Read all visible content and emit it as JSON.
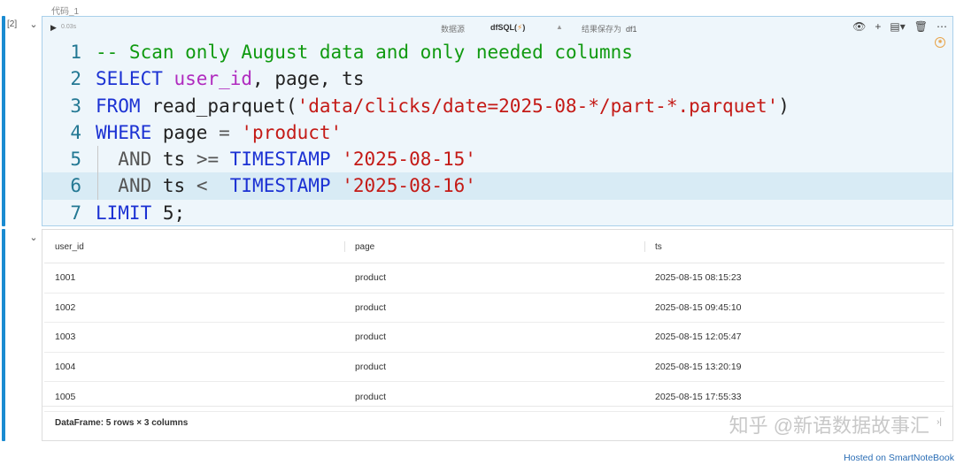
{
  "cell": {
    "title": "代码_1",
    "exec_count": "[2]",
    "collapse_icon": "chevron-down-icon"
  },
  "toolbar": {
    "run_icon": "▶",
    "elapsed": "0.03s",
    "datasource_label": "数据源",
    "language_label": "dfSQL(",
    "language_bolt": "⚡",
    "language_close": ")",
    "language_caret": "▲",
    "save_as_label": "结果保存为",
    "save_as_value": "df1",
    "icons": [
      "eye-icon",
      "plus-icon",
      "layers-icon",
      "trash-icon",
      "more-icon"
    ]
  },
  "code": {
    "lines": [
      {
        "n": "1",
        "parts": [
          {
            "t": "-- Scan only August data and only needed columns",
            "c": "cm"
          }
        ]
      },
      {
        "n": "2",
        "parts": [
          {
            "t": "SELECT",
            "c": "kw"
          },
          {
            "t": " "
          },
          {
            "t": "user_id",
            "c": "id"
          },
          {
            "t": ", page, ts"
          }
        ]
      },
      {
        "n": "3",
        "parts": [
          {
            "t": "FROM",
            "c": "kw"
          },
          {
            "t": " read_parquet("
          },
          {
            "t": "'data/clicks/date=2025-08-*/part-*.parquet'",
            "c": "str"
          },
          {
            "t": ")"
          }
        ]
      },
      {
        "n": "4",
        "parts": [
          {
            "t": "WHERE",
            "c": "kw"
          },
          {
            "t": " page "
          },
          {
            "t": "=",
            "c": "op"
          },
          {
            "t": " "
          },
          {
            "t": "'product'",
            "c": "str"
          }
        ]
      },
      {
        "n": "5",
        "parts": [
          {
            "t": "  "
          },
          {
            "t": "AND",
            "c": "op"
          },
          {
            "t": " ts "
          },
          {
            "t": ">=",
            "c": "op"
          },
          {
            "t": " "
          },
          {
            "t": "TIMESTAMP",
            "c": "kw"
          },
          {
            "t": " "
          },
          {
            "t": "'2025-08-15'",
            "c": "str"
          }
        ],
        "guide": true
      },
      {
        "n": "6",
        "parts": [
          {
            "t": "  "
          },
          {
            "t": "AND",
            "c": "op"
          },
          {
            "t": " ts "
          },
          {
            "t": "<",
            "c": "op"
          },
          {
            "t": "  "
          },
          {
            "t": "TIMESTAMP",
            "c": "kw"
          },
          {
            "t": " "
          },
          {
            "t": "'2025-08-16'",
            "c": "str"
          }
        ],
        "guide": true,
        "active": true
      },
      {
        "n": "7",
        "parts": [
          {
            "t": "LIMIT",
            "c": "kw"
          },
          {
            "t": " 5;"
          }
        ]
      }
    ]
  },
  "output": {
    "columns": [
      "user_id",
      "page",
      "ts"
    ],
    "rows": [
      [
        "1001",
        "product",
        "2025-08-15 08:15:23"
      ],
      [
        "1002",
        "product",
        "2025-08-15 09:45:10"
      ],
      [
        "1003",
        "product",
        "2025-08-15 12:05:47"
      ],
      [
        "1004",
        "product",
        "2025-08-15 13:20:19"
      ],
      [
        "1005",
        "product",
        "2025-08-15 17:55:33"
      ]
    ],
    "summary": "DataFrame: 5 rows × 3 columns"
  },
  "watermark": "知乎 @新语数据故事汇",
  "hosted": "Hosted on SmartNoteBook",
  "colors": {
    "accent": "#1a8bd1",
    "keyword": "#1b31d3",
    "string": "#c41a16",
    "comment": "#109a10",
    "identifier": "#b02bbf"
  }
}
